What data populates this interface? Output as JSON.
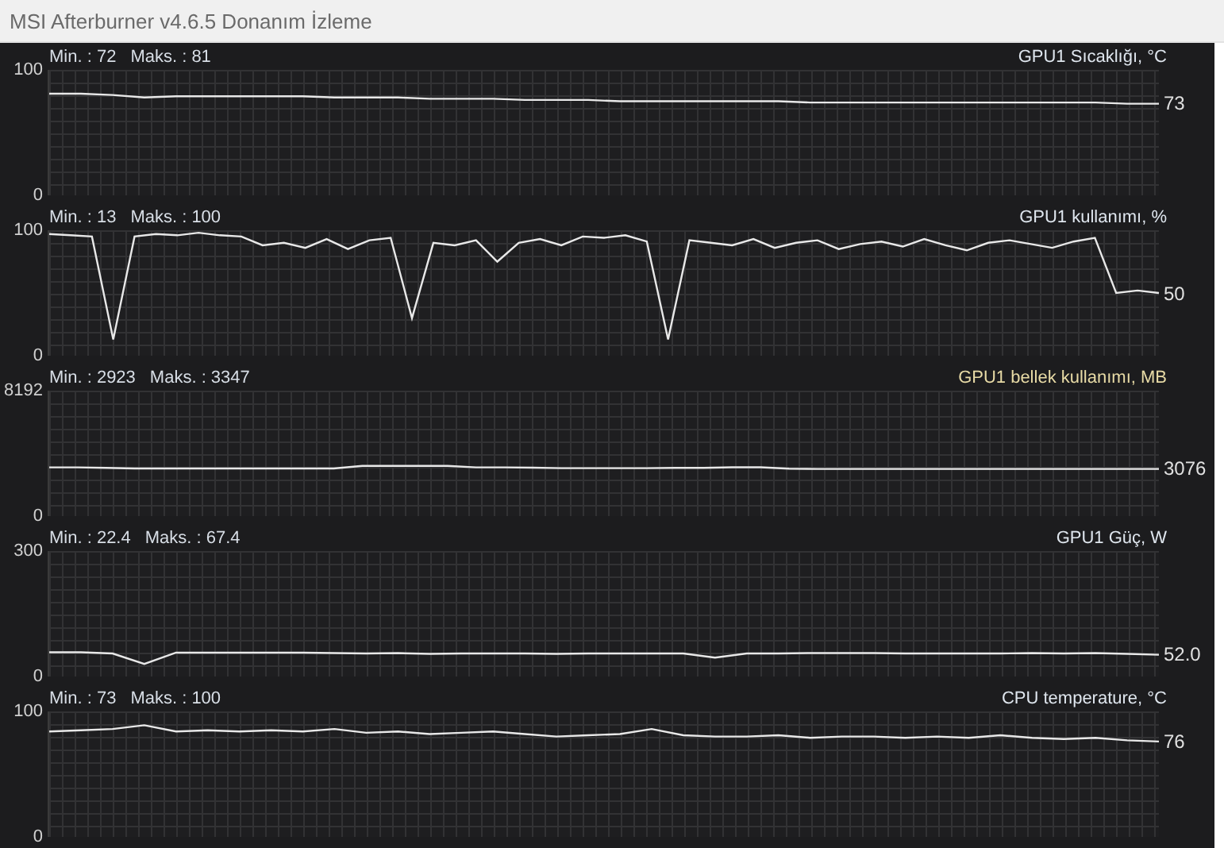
{
  "window": {
    "title": "MSI Afterburner v4.6.5 Donanım İzleme"
  },
  "graphs": [
    {
      "min_label": "Min. : 72",
      "max_label": "Maks. : 81",
      "title": "GPU1 Sıcaklığı, °C",
      "color": "#dfe6ee",
      "current": "73",
      "chart_data": {
        "type": "line",
        "ylim": [
          0,
          100
        ],
        "yticks": [
          {
            "value": 0,
            "label": "0"
          },
          {
            "value": 100,
            "label": "100"
          }
        ],
        "series": [
          {
            "color": "#e8e8e8",
            "values": [
              81,
              81,
              80,
              78,
              79,
              79,
              79,
              79,
              79,
              78,
              78,
              78,
              77,
              77,
              77,
              76,
              76,
              76,
              75,
              75,
              75,
              75,
              75,
              75,
              74,
              74,
              74,
              74,
              74,
              74,
              74,
              74,
              74,
              74,
              73,
              73
            ]
          }
        ]
      }
    },
    {
      "min_label": "Min. : 13",
      "max_label": "Maks. : 100",
      "title": "GPU1 kullanımı, %",
      "color": "#dfe6ee",
      "current": "50",
      "chart_data": {
        "type": "line",
        "ylim": [
          0,
          100
        ],
        "yticks": [
          {
            "value": 0,
            "label": "0"
          },
          {
            "value": 100,
            "label": "100"
          }
        ],
        "series": [
          {
            "color": "#e8e8e8",
            "values": [
              97,
              96,
              95,
              13,
              95,
              97,
              96,
              98,
              96,
              95,
              88,
              90,
              86,
              93,
              85,
              92,
              94,
              30,
              90,
              88,
              92,
              75,
              90,
              93,
              88,
              95,
              94,
              96,
              91,
              13,
              92,
              90,
              88,
              93,
              86,
              90,
              92,
              85,
              89,
              91,
              87,
              93,
              88,
              84,
              90,
              92,
              89,
              86,
              91,
              94,
              50,
              52,
              50
            ]
          }
        ]
      }
    },
    {
      "min_label": "Min. : 2923",
      "max_label": "Maks. : 3347",
      "title": "GPU1 bellek kullanımı, MB",
      "color": "#e8dba6",
      "current": "3076",
      "chart_data": {
        "type": "line",
        "ylim": [
          0,
          8192
        ],
        "yticks": [
          {
            "value": 0,
            "label": "0"
          },
          {
            "value": 8192,
            "label": "8192"
          }
        ],
        "series": [
          {
            "color": "#e8e8e8",
            "values": [
              3180,
              3180,
              3150,
              3110,
              3110,
              3110,
              3110,
              3110,
              3110,
              3110,
              3110,
              3280,
              3280,
              3280,
              3280,
              3180,
              3180,
              3160,
              3130,
              3130,
              3130,
              3130,
              3150,
              3150,
              3190,
              3190,
              3100,
              3076,
              3076,
              3076,
              3076,
              3076,
              3076,
              3076,
              3076,
              3076,
              3076,
              3076,
              3076,
              3076
            ]
          }
        ]
      }
    },
    {
      "min_label": "Min. : 22.4",
      "max_label": "Maks. : 67.4",
      "title": "GPU1 Güç, W",
      "color": "#dfe6ee",
      "current": "52.0",
      "chart_data": {
        "type": "line",
        "ylim": [
          0,
          300
        ],
        "yticks": [
          {
            "value": 0,
            "label": "0"
          },
          {
            "value": 300,
            "label": "300"
          }
        ],
        "series": [
          {
            "color": "#e8e8e8",
            "values": [
              58,
              58,
              55,
              30,
              57,
              57,
              57,
              57,
              57,
              56,
              55,
              56,
              54,
              55,
              55,
              55,
              54,
              55,
              55,
              55,
              55,
              45,
              55,
              55,
              56,
              56,
              56,
              55,
              55,
              55,
              55,
              56,
              55,
              56,
              54,
              52
            ]
          }
        ]
      }
    },
    {
      "min_label": "Min. : 73",
      "max_label": "Maks. : 100",
      "title": "CPU temperature, °C",
      "color": "#dfe6ee",
      "current": "76",
      "chart_data": {
        "type": "line",
        "ylim": [
          0,
          100
        ],
        "yticks": [
          {
            "value": 0,
            "label": "0"
          },
          {
            "value": 100,
            "label": "100"
          }
        ],
        "series": [
          {
            "color": "#e8e8e8",
            "values": [
              84,
              85,
              86,
              89,
              84,
              85,
              84,
              85,
              84,
              86,
              83,
              84,
              82,
              83,
              84,
              82,
              80,
              81,
              82,
              86,
              81,
              80,
              80,
              81,
              79,
              80,
              80,
              79,
              80,
              79,
              81,
              79,
              78,
              79,
              77,
              76
            ]
          }
        ]
      }
    }
  ]
}
